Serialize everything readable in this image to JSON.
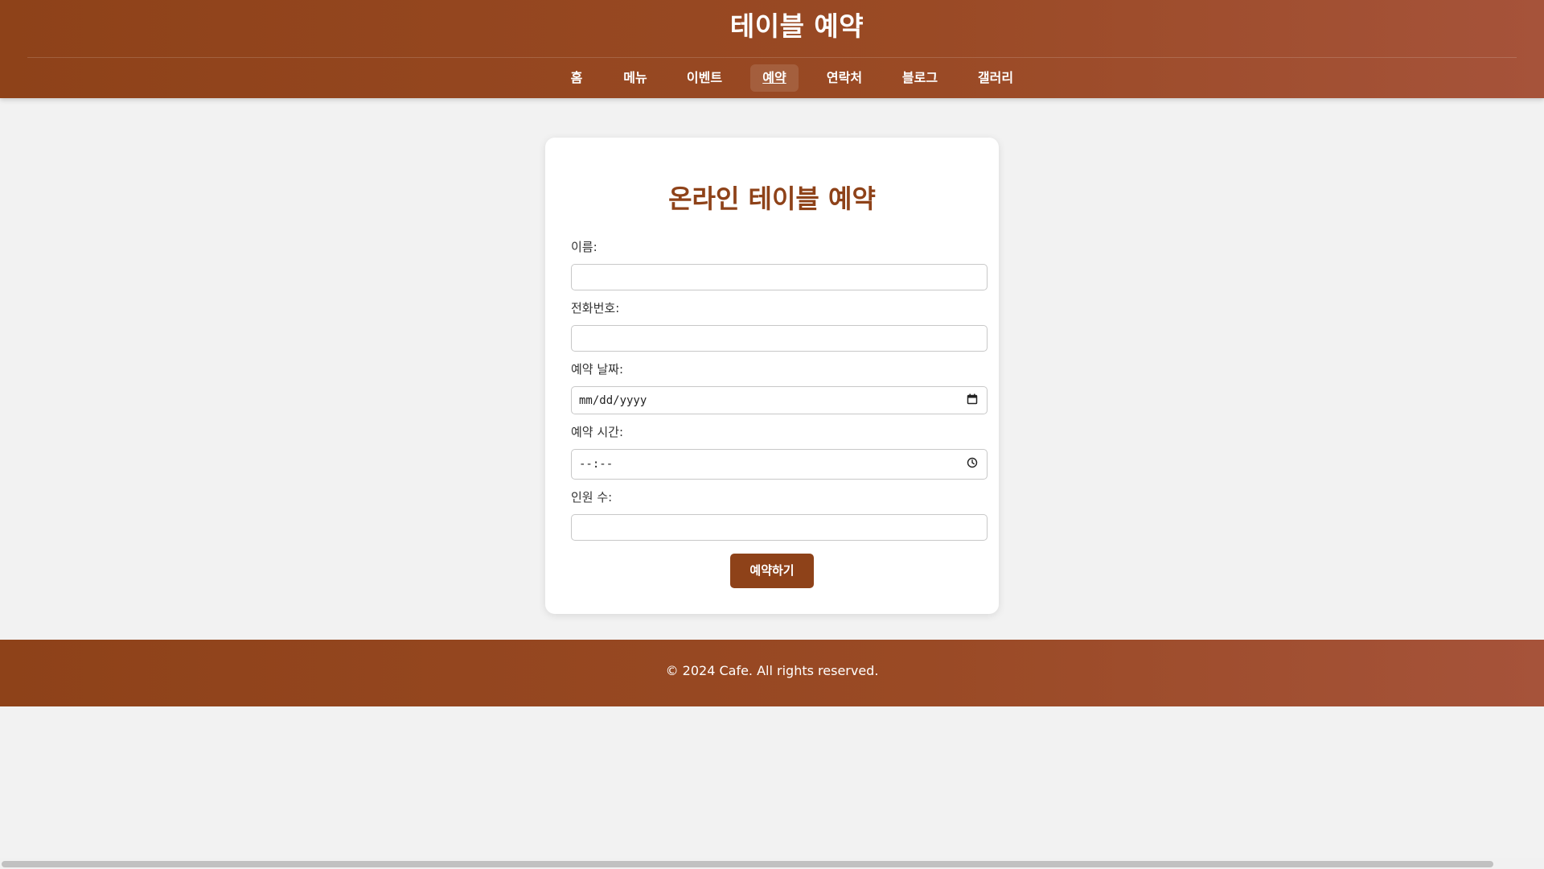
{
  "header": {
    "title": "테이블 예약",
    "nav": [
      {
        "label": "홈"
      },
      {
        "label": "메뉴"
      },
      {
        "label": "이벤트"
      },
      {
        "label": "예약",
        "active": true
      },
      {
        "label": "연락처"
      },
      {
        "label": "블로그"
      },
      {
        "label": "갤러리"
      }
    ]
  },
  "form": {
    "title": "온라인 테이블 예약",
    "name_label": "이름:",
    "name_value": "",
    "phone_label": "전화번호:",
    "phone_value": "",
    "date_label": "예약 날짜:",
    "date_placeholder": "mm/dd/yyyy",
    "time_label": "예약 시간:",
    "time_placeholder": "--:--",
    "guests_label": "인원 수:",
    "guests_value": "",
    "submit_label": "예약하기"
  },
  "footer": {
    "text": "© 2024 Cafe. All rights reserved."
  },
  "colors": {
    "brand": "#8e4219",
    "background": "#f2f2f2",
    "card": "#ffffff"
  },
  "icons": {
    "date": "calendar-icon",
    "time": "clock-icon"
  }
}
